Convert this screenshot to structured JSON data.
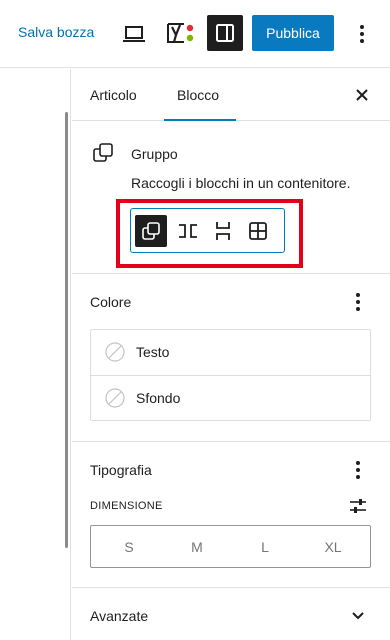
{
  "toolbar": {
    "save_draft": "Salva bozza",
    "publish": "Pubblica",
    "icons": [
      "laptop-icon",
      "yoast-icon",
      "sidebar-toggle-icon",
      "more-vertical-icon"
    ]
  },
  "sidebar": {
    "tabs": [
      {
        "label": "Articolo",
        "active": false
      },
      {
        "label": "Blocco",
        "active": true
      }
    ],
    "block": {
      "title": "Gruppo",
      "description": "Raccogli i blocchi in un contenitore.",
      "variations": [
        "Gruppo",
        "Riga",
        "Pila",
        "Griglia"
      ],
      "active_variation": "Gruppo"
    },
    "color": {
      "title": "Colore",
      "items": [
        {
          "label": "Testo"
        },
        {
          "label": "Sfondo"
        }
      ]
    },
    "typography": {
      "title": "Tipografia",
      "size_label": "DIMENSIONE",
      "sizes": [
        "S",
        "M",
        "L",
        "XL"
      ]
    },
    "advanced": {
      "title": "Avanzate"
    }
  },
  "colors": {
    "accent": "#007cba",
    "publish_bg": "#0a7ac0",
    "highlight": "#e3001b",
    "dark": "#1e1e1e"
  }
}
